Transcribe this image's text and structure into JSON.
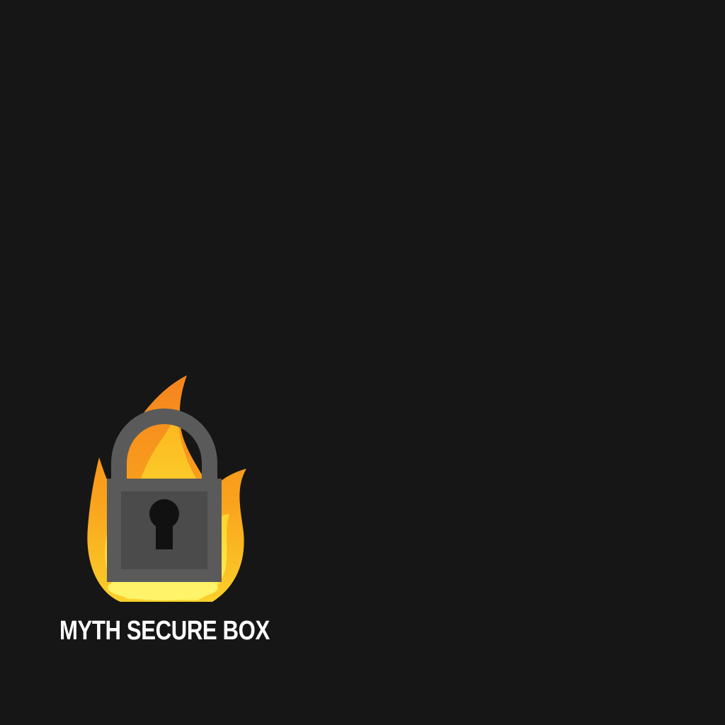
{
  "app": {
    "title": "MYTH SECURE BOX",
    "logo_icon": "flaming-padlock-icon"
  },
  "colors": {
    "background": "#161616",
    "title_text": "#ffffff",
    "flame_outer": "#f5841f",
    "flame_mid": "#f9b21a",
    "flame_inner": "#ffe94a",
    "lock_body": "#5a5a5a",
    "lock_face": "#4a4a4a",
    "keyhole": "#111111"
  }
}
